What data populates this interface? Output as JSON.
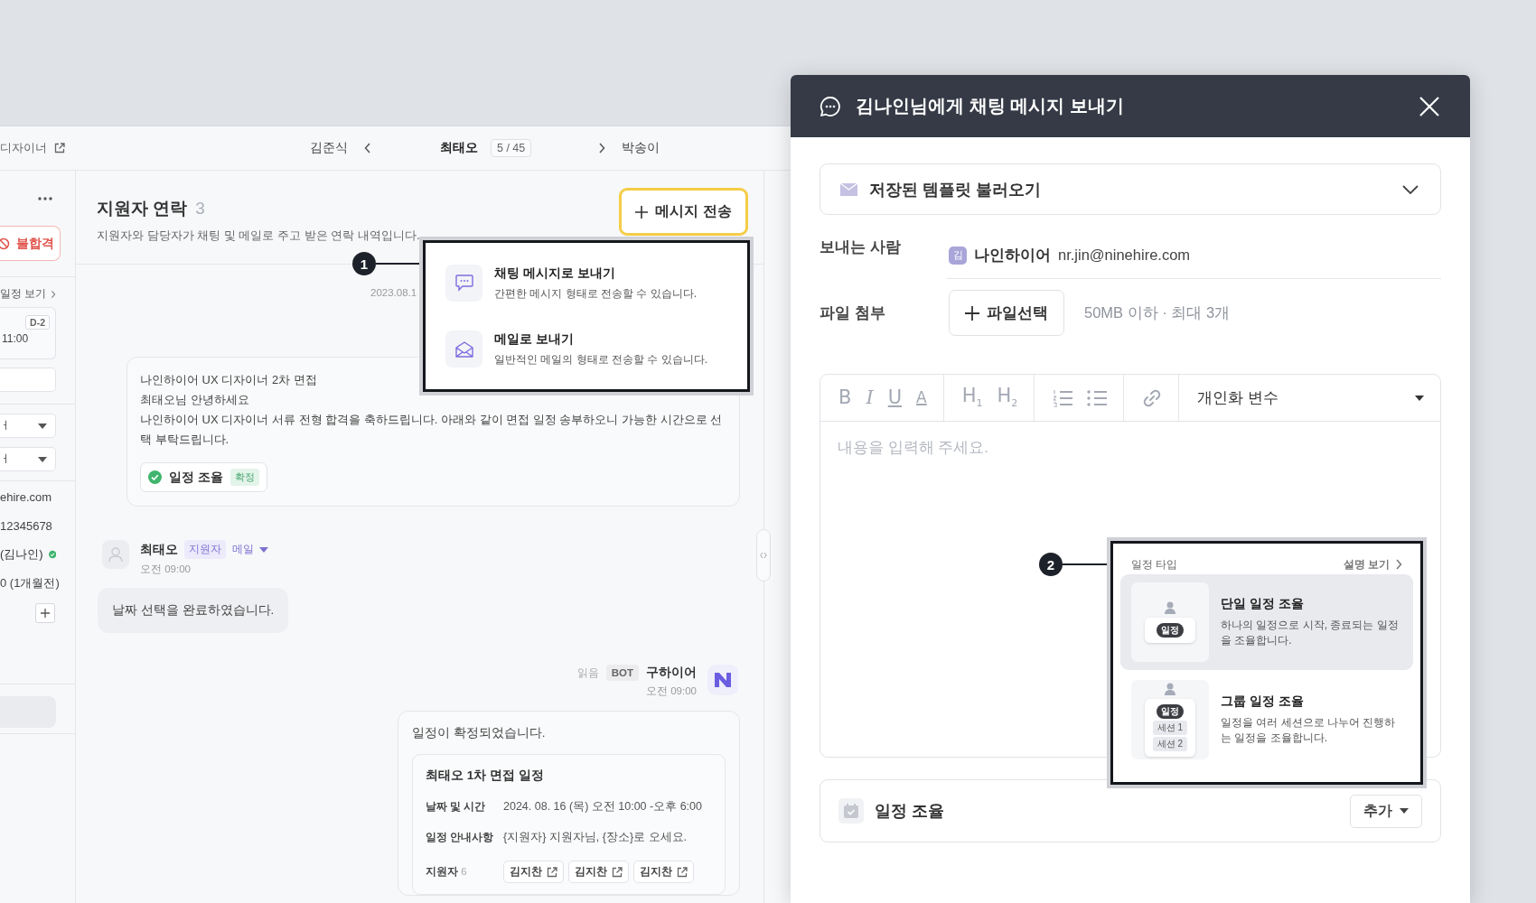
{
  "header": {
    "context": "디자이너",
    "previous": "김준식",
    "current": "최태오",
    "position": "5 / 45",
    "next": "박송이"
  },
  "sidebar": {
    "reject_button": "불합격",
    "schedule_link": "일정 보기",
    "schedule_badge": "D-2",
    "schedule_time": "11:00",
    "selects": [
      "ㅓ",
      "ㅓ"
    ],
    "info": [
      {
        "text": "ehire.com",
        "verified": false
      },
      {
        "text": "12345678",
        "verified": false
      },
      {
        "text": "(김나인)",
        "verified": true
      },
      {
        "text": "0 (1개월전)",
        "verified": false
      }
    ]
  },
  "contacts": {
    "title": "지원자 연락",
    "count": "3",
    "subtitle": "지원자와 담당자가 채팅 및 메일로 주고 받은 연락 내역입니다.",
    "send_button": "메시지 전송",
    "date": "2023.08.1",
    "outgoing": {
      "lines": [
        "나인하이어 UX 디자이너 2차 면접",
        "최태오님 안녕하세요",
        "나인하이어 UX 디자이너 서류 전형 합격을 축하드립니다. 아래와 같이 면접 일정 송부하오니 가능한 시간으로 선택 부탁드립니다."
      ],
      "chip": {
        "label": "일정 조율",
        "status": "확정"
      }
    },
    "reply": {
      "sender": "최태오",
      "role": "지원자",
      "channel": "메일",
      "time": "오전 09:00",
      "text": "날짜 선택을 완료하였습니다."
    },
    "bot": {
      "read": "읽음",
      "badge": "BOT",
      "sender": "구하이어",
      "time": "오전 09:00",
      "text": "일정이 확정되었습니다.",
      "schedule": {
        "title": "최태오 1차 면접 일정",
        "rows": [
          {
            "label": "날짜 및 시간",
            "value": "2024. 08. 16 (목) 오전 10:00 -오후 6:00"
          },
          {
            "label": "일정 안내사항",
            "value": "{지원자} 지원자님, {장소}로 오세요."
          }
        ],
        "applicants": {
          "label": "지원자",
          "count": "6",
          "chips": [
            "김지찬",
            "김지찬",
            "김지찬"
          ]
        }
      }
    }
  },
  "send_menu": {
    "marker": "1",
    "items": [
      {
        "kind": "chat",
        "title": "채팅 메시지로 보내기",
        "description": "간편한 메시지 형태로 전송할 수 있습니다."
      },
      {
        "kind": "mail",
        "title": "메일로 보내기",
        "description": "일반적인 메일의 형태로 전송할 수 있습니다."
      }
    ]
  },
  "modal": {
    "title": "김나인님에게 채팅 메시지 보내기",
    "template": "저장된 템플릿 불러오기",
    "sender": {
      "label": "보내는 사람",
      "avatar": "김",
      "name": "나인하이어",
      "email": "nr.jin@ninehire.com"
    },
    "attachment": {
      "label": "파일 첨부",
      "button": "파일선택",
      "hint": "50MB 이하 · 최대 3개"
    },
    "editor": {
      "toolbar": [
        {
          "kind": "bold",
          "glyph": "B"
        },
        {
          "kind": "italic",
          "glyph": "I"
        },
        {
          "kind": "underline",
          "glyph": "U"
        },
        {
          "kind": "color",
          "glyph": "A"
        },
        {
          "kind": "heading",
          "glyph": "H$_{1}$"
        },
        {
          "kind": "heading",
          "glyph": "H$_{2}$"
        },
        {
          "kind": "ordered-list"
        },
        {
          "kind": "bullet-list"
        },
        {
          "kind": "link"
        }
      ],
      "variables": "개인화 변수",
      "placeholder": "내용을 입력해 주세요."
    },
    "schedule": {
      "label": "일정 조율",
      "button": "추가"
    }
  },
  "type_menu": {
    "marker": "2",
    "title": "일정 타입",
    "help": "설명 보기",
    "options": [
      {
        "title": "단일 일정 조율",
        "description": "하나의 일정으로 시작, 종료되는 일정을 조율합니다.",
        "selected": true,
        "tags": [
          "일정"
        ]
      },
      {
        "title": "그룹 일정 조율",
        "description": "일정을 여러 세션으로 나누어 진행하는 일정을 조율합니다.",
        "selected": false,
        "tags": [
          "일정",
          "세션 1",
          "세션 2"
        ]
      }
    ]
  }
}
